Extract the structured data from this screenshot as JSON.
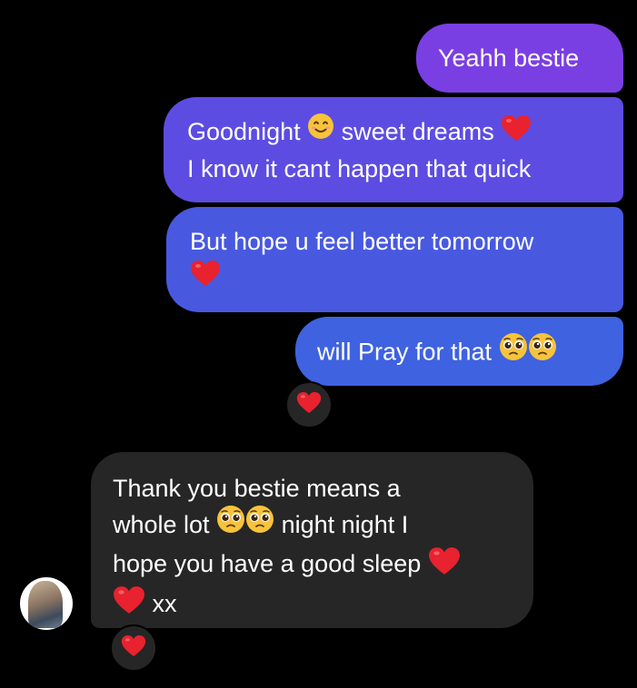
{
  "conversation": {
    "sent": [
      {
        "lines": [
          [
            "Yeahh bestie"
          ]
        ]
      },
      {
        "lines": [
          [
            "Goodnight ",
            "{smile-emoji}",
            " sweet dreams ",
            "{heart-emoji}"
          ],
          [
            "I know it cant happen that quick"
          ]
        ]
      },
      {
        "lines": [
          [
            "But hope u feel better tomorrow"
          ],
          [
            "{heart-emoji}"
          ]
        ]
      },
      {
        "lines": [
          [
            "will Pray for that ",
            "{pleading-emoji}",
            "{pleading-emoji}"
          ]
        ]
      }
    ],
    "sent_text": {
      "b1_l1": "Yeahh bestie",
      "b2_l1a": "Goodnight",
      "b2_l1b": "sweet dreams",
      "b2_l2": "I know it cant happen that quick",
      "b3_l1": "But hope u feel better tomorrow",
      "b4_l1": "will Pray for that"
    },
    "received_text": {
      "l1": "Thank you bestie means a",
      "l2a": "whole lot",
      "l2b": "night night I",
      "l3": "hope you have a good sleep",
      "l4": "xx"
    },
    "reactions": [
      "heart-emoji",
      "heart-emoji"
    ]
  },
  "colors": {
    "background": "#000000",
    "sent_top": "#7a3fe3",
    "sent_bottom": "#3f62e0",
    "received": "#262626",
    "heart": "#e8222f",
    "emoji_face": "#f7c33b"
  }
}
